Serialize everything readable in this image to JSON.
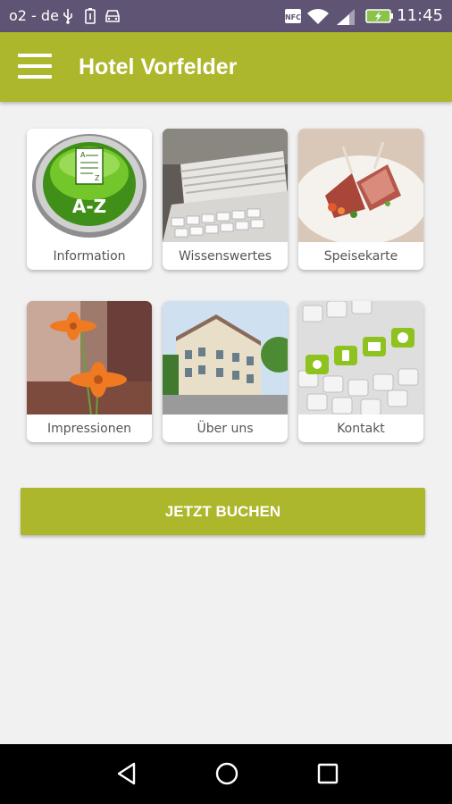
{
  "status_bar": {
    "carrier": "o2 - de",
    "time": "11:45",
    "icons": [
      "usb-icon",
      "battery-saver-icon",
      "car-icon",
      "nfc-icon",
      "wifi-icon",
      "signal-icon",
      "battery-charging-icon"
    ]
  },
  "app_bar": {
    "title": "Hotel Vorfelder",
    "menu_icon": "hamburger-menu-icon"
  },
  "tiles": [
    {
      "label": "Information",
      "image": "a-z-directory-icon"
    },
    {
      "label": "Wissenswertes",
      "image": "newspapers-photo"
    },
    {
      "label": "Speisekarte",
      "image": "food-plate-photo"
    },
    {
      "label": "Impressionen",
      "image": "flower-photo"
    },
    {
      "label": "Über uns",
      "image": "hotel-building-photo"
    },
    {
      "label": "Kontakt",
      "image": "keyboard-contact-photo"
    }
  ],
  "book_button": {
    "label": "JETZT BUCHEN"
  },
  "nav_bar": {
    "icons": [
      "back-icon",
      "home-icon",
      "recents-icon"
    ]
  },
  "colors": {
    "accent": "#adb72b",
    "status_bar": "#5f5473",
    "background": "#f1f1f1"
  }
}
